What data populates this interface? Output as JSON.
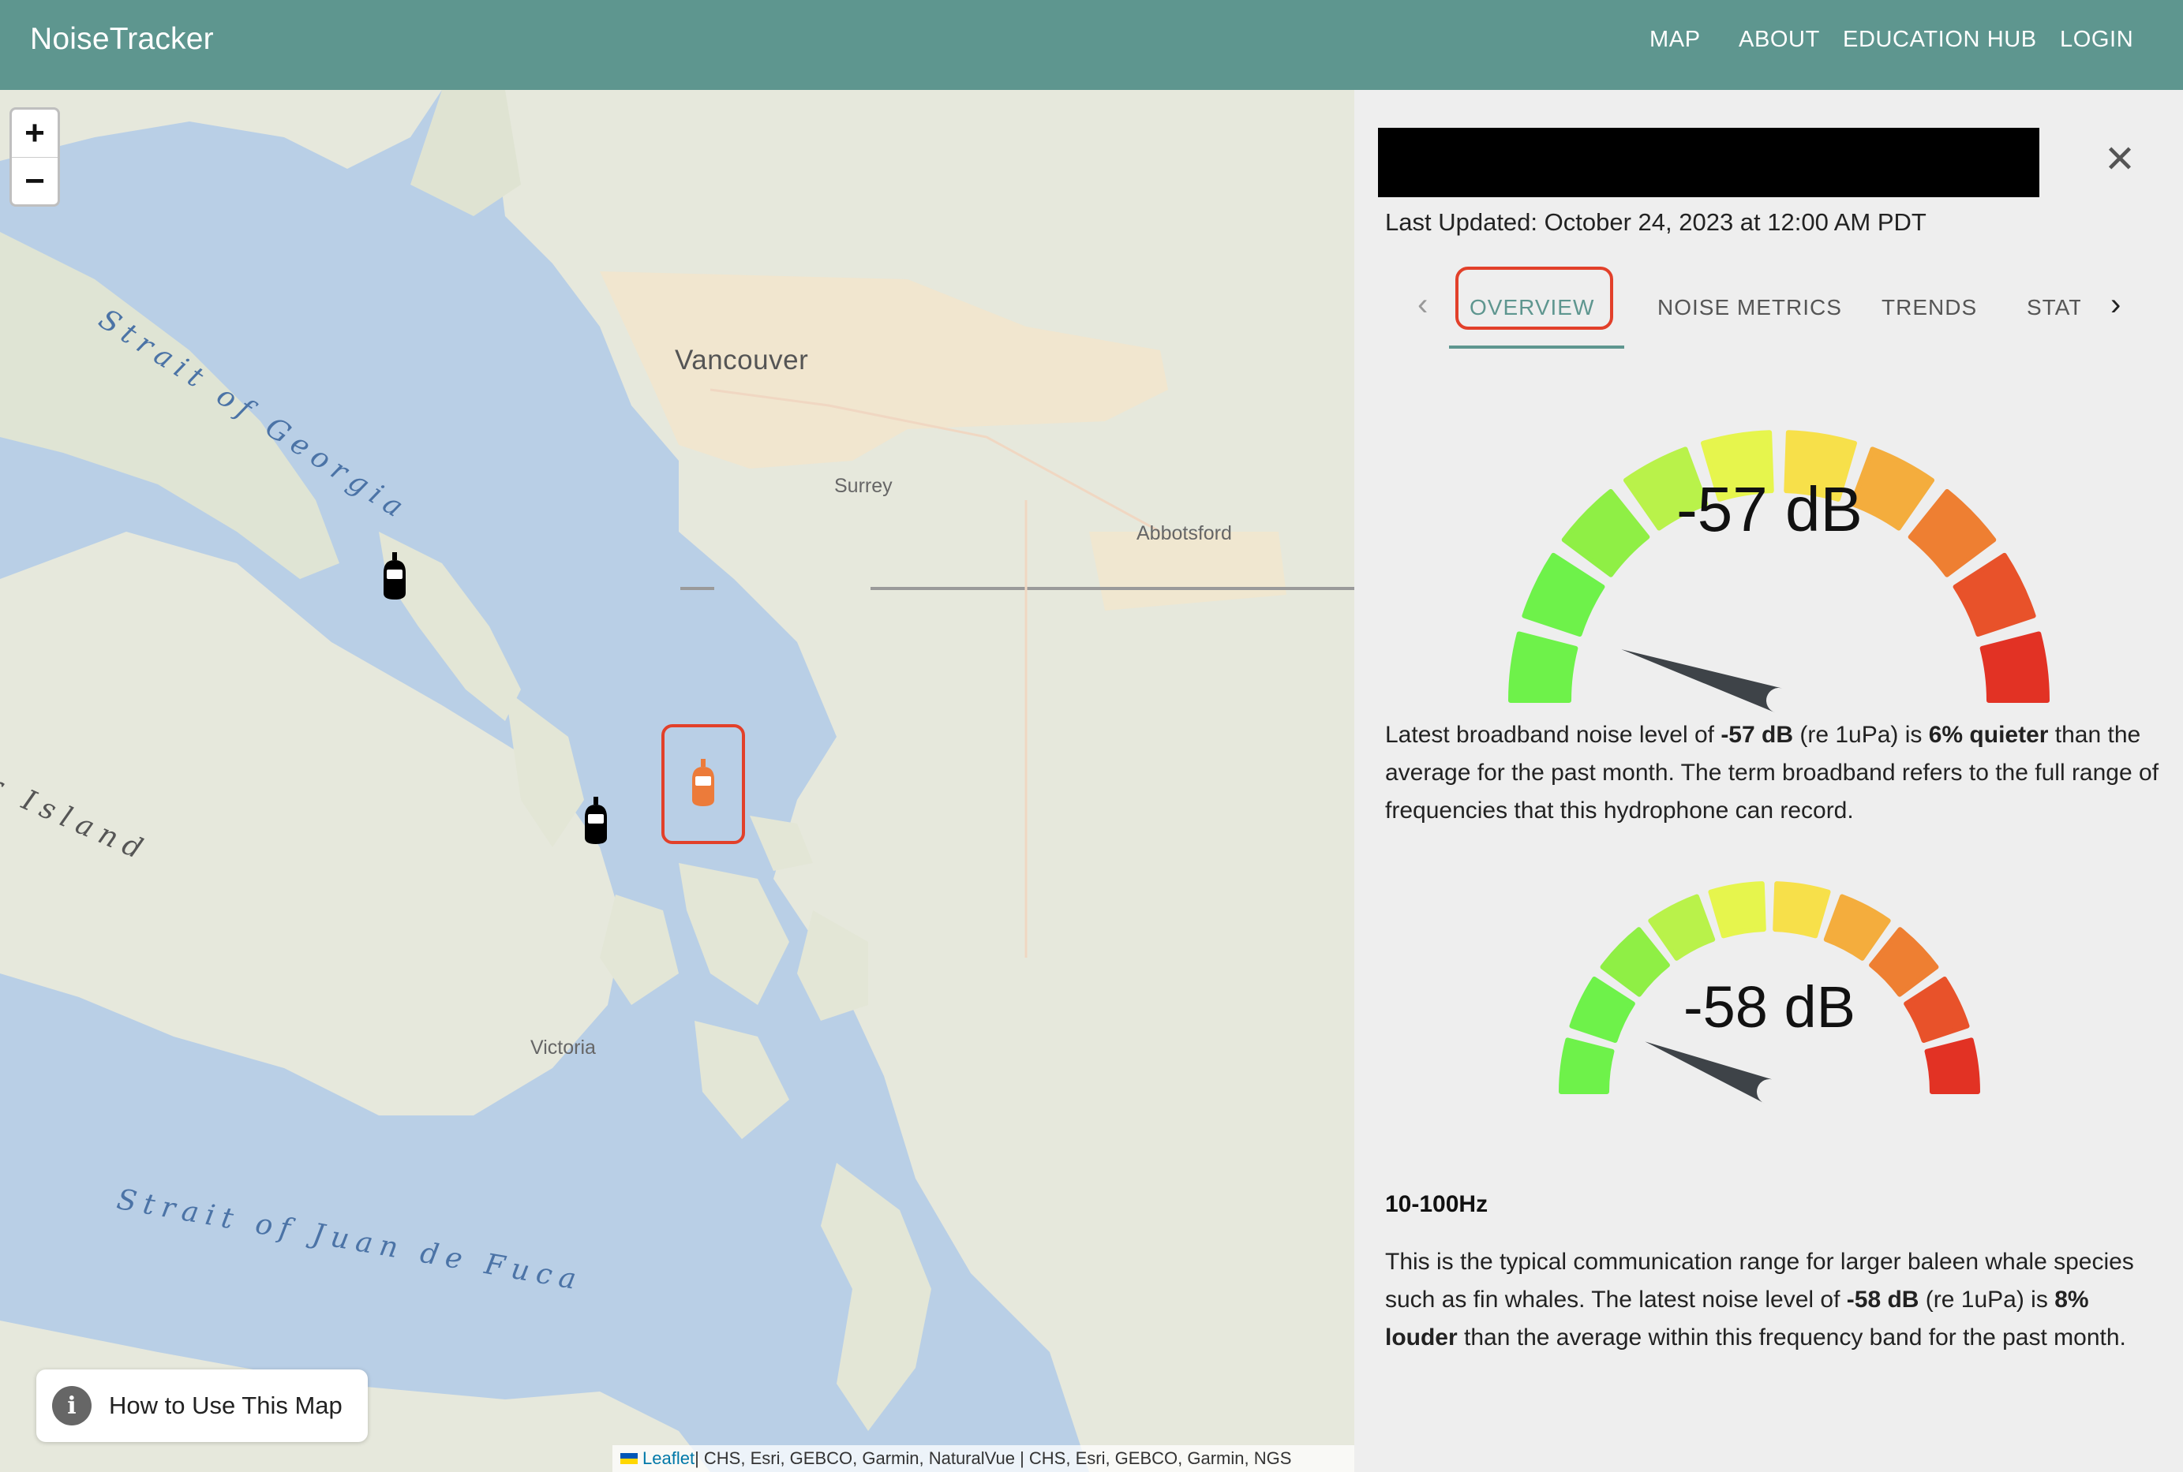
{
  "header": {
    "brand": "NoiseTracker",
    "nav": [
      "MAP",
      "ABOUT",
      "EDUCATION HUB",
      "LOGIN"
    ]
  },
  "map": {
    "zoom_in": "+",
    "zoom_out": "−",
    "labels": {
      "strait_georgia": "Strait of Georgia",
      "vancouver": "Vancouver",
      "surrey": "Surrey",
      "abbotsford": "Abbotsford",
      "island": "r Island",
      "victoria": "Victoria",
      "strait_juan": "Strait of Juan de Fuca"
    },
    "how_to": "How to Use This Map",
    "attribution_link": "Leaflet",
    "attribution_text": " | CHS, Esri, GEBCO, Garmin, NaturalVue | CHS, Esri, GEBCO, Garmin, NGS",
    "colors": {
      "water": "#b9cfe6",
      "land": "#e6e8dc",
      "urban": "#f2e6cd",
      "selected": "#e2402a",
      "selected_marker": "#ec7b3a"
    }
  },
  "panel": {
    "close": "✕",
    "last_updated": "Last Updated: October 24, 2023 at 12:00 AM PDT",
    "tabs": [
      "OVERVIEW",
      "NOISE METRICS",
      "TRENDS",
      "STATI"
    ],
    "tab_prev": "‹",
    "tab_next": "›",
    "broadband": {
      "value_label": "-57 dB",
      "text_pre": "Latest broadband noise level of ",
      "value_bold": "-57 dB",
      "text_mid": " (re 1uPa) is ",
      "change_bold": "6% quieter",
      "text_post": " than the average for the past month. The term broadband refers to the full range of frequencies that this hydrophone can record."
    },
    "band": {
      "title": "10-100Hz",
      "value_label": "-58 dB",
      "text_pre": "This is the typical communication range for larger baleen whale species such as fin whales. The latest noise level of ",
      "value_bold": "-58 dB",
      "text_mid": " (re 1uPa) is ",
      "change_bold": "8% louder",
      "text_post": " than the average within this frequency band for the past month."
    },
    "gauge_colors": [
      "#6ef24a",
      "#6ef24a",
      "#8fef45",
      "#b9f24a",
      "#e6f54d",
      "#f7e04a",
      "#f4ad3d",
      "#ee7f32",
      "#e8522a",
      "#e23224"
    ]
  }
}
